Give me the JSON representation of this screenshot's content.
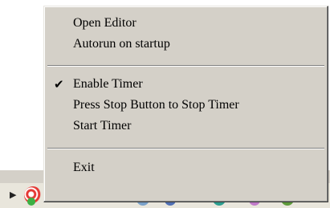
{
  "menu": {
    "items": [
      {
        "label": "Open Editor"
      },
      {
        "label": "Autorun on startup"
      },
      {
        "label": "Enable Timer",
        "checked": true,
        "check_glyph": "✔"
      },
      {
        "label": "Press Stop Button to Stop Timer"
      },
      {
        "label": "Start Timer"
      },
      {
        "label": "Exit"
      }
    ]
  },
  "taskbar": {
    "tray_icons": [
      "chevron-right-icon",
      "app-tray-icon",
      "network-icon",
      "volume-icon",
      "security-icon",
      "update-icon",
      "shield-icon"
    ]
  }
}
